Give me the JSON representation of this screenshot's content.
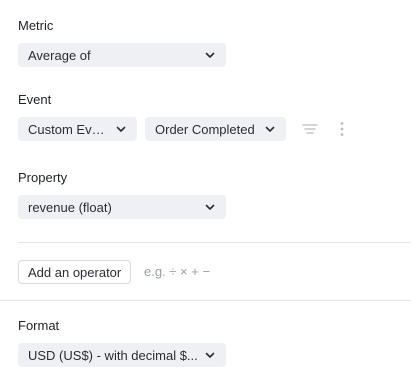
{
  "metric": {
    "label": "Metric",
    "value": "Average of"
  },
  "event": {
    "label": "Event",
    "type_value": "Custom Event",
    "name_value": "Order Completed",
    "filter_icon": "filter-lines-icon",
    "more_icon": "vertical-ellipsis-icon"
  },
  "property": {
    "label": "Property",
    "value": "revenue (float)"
  },
  "operator": {
    "button_label": "Add an operator",
    "hint": "e.g. ÷ × + −"
  },
  "format": {
    "label": "Format",
    "value": "USD (US$) - with decimal $..."
  },
  "colors": {
    "select_bg": "#eef0f3",
    "text": "#1f2329",
    "muted": "#9aa0a8",
    "divider": "#e4e6ea"
  }
}
